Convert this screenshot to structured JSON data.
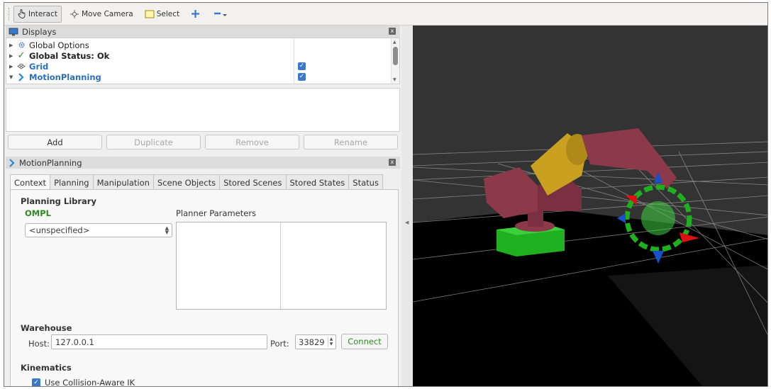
{
  "toolbar": {
    "interact": "Interact",
    "move_camera": "Move Camera",
    "select": "Select"
  },
  "displays": {
    "title": "Displays",
    "close": "x",
    "items": [
      {
        "label": "Global Options"
      },
      {
        "label": "Global Status: Ok"
      },
      {
        "label": "Grid",
        "checked": true
      },
      {
        "label": "MotionPlanning",
        "checked": true
      }
    ],
    "buttons": {
      "add": "Add",
      "duplicate": "Duplicate",
      "remove": "Remove",
      "rename": "Rename"
    }
  },
  "motion_planning": {
    "title": "MotionPlanning",
    "close": "x",
    "tabs": [
      "Context",
      "Planning",
      "Manipulation",
      "Scene Objects",
      "Stored Scenes",
      "Stored States",
      "Status"
    ],
    "active_tab": "Context",
    "planning_library": {
      "title": "Planning Library",
      "library": "OMPL",
      "planner_params_label": "Planner Parameters",
      "planner_selected": "<unspecified>"
    },
    "warehouse": {
      "title": "Warehouse",
      "host_label": "Host:",
      "host_value": "127.0.0.1",
      "port_label": "Port:",
      "port_value": "33829",
      "connect": "Connect"
    },
    "kinematics": {
      "title": "Kinematics",
      "collision_aware_ik": "Use Collision-Aware IK",
      "collision_aware_ik_checked": true
    }
  },
  "colors": {
    "accent_blue": "#2a6fbf",
    "checkbox_blue": "#3c78c8",
    "green_text": "#2f8a24",
    "viewport_bg": "#333333",
    "robot_base": "#1fb01f",
    "robot_link_pink": "#8c3a4a",
    "robot_link_yellow": "#c9a020"
  },
  "icons": {
    "interact": "hand-pointer-icon",
    "move_camera": "move-camera-icon",
    "select": "select-rect-icon",
    "focus": "crosshair-plus-icon",
    "measure": "minus-dropdown-icon",
    "displays": "monitor-icon",
    "global_options": "gear-icon",
    "global_status": "checkmark-icon",
    "grid": "grid-icon",
    "motion_planning": "motion-planning-icon"
  }
}
